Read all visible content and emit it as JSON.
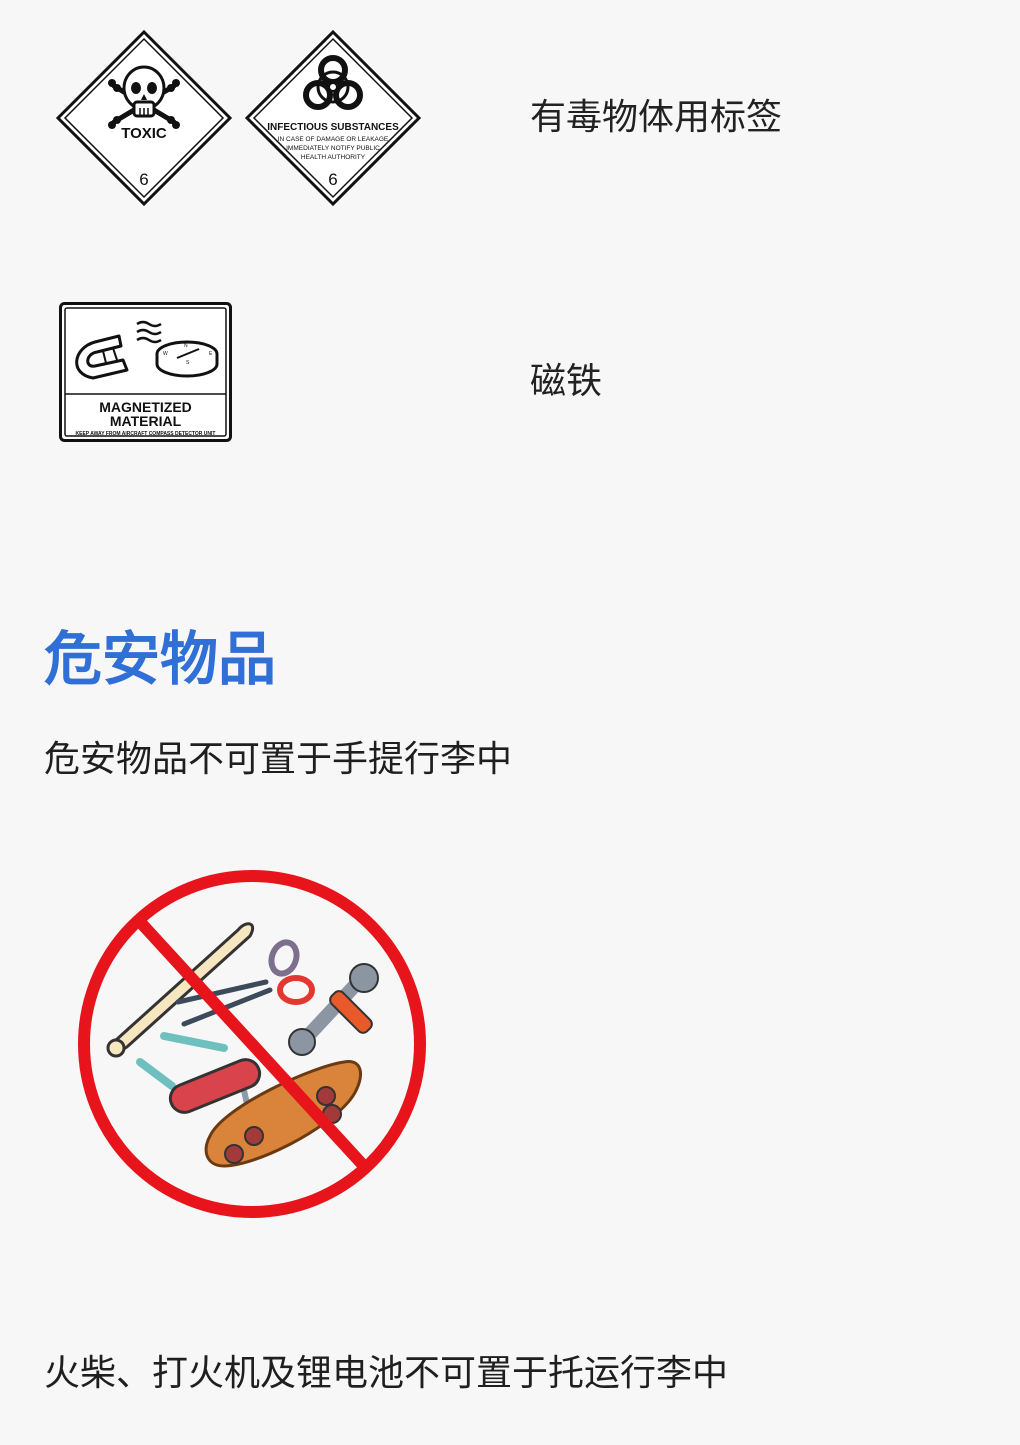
{
  "labels": {
    "toxic": {
      "sign_text": "TOXIC",
      "sign_class": "6",
      "caption": "有毒物体用标签"
    },
    "infectious": {
      "sign_title": "INFECTIOUS SUBSTANCES",
      "sign_line1": "IN CASE OF DAMAGE OR LEAKAGE",
      "sign_line2": "IMMEDIATELY NOTIFY PUBLIC",
      "sign_line3": "HEALTH AUTHORITY",
      "sign_class": "6"
    },
    "magnet": {
      "sign_line1": "MAGNETIZED",
      "sign_line2": "MATERIAL",
      "sign_line3": "KEEP AWAY FROM AIRCRAFT COMPASS DETECTOR UNIT",
      "compass_w": "W",
      "compass_n": "N",
      "compass_e": "E",
      "compass_s": "S",
      "caption": "磁铁"
    }
  },
  "section": {
    "title": "危安物品",
    "paragraph1": "危安物品不可置于手提行李中",
    "paragraph2": "火柴、打火机及锂电池不可置于托运行李中"
  },
  "colors": {
    "title_blue": "#2f6fd6",
    "prohibit_red": "#e8141c"
  }
}
